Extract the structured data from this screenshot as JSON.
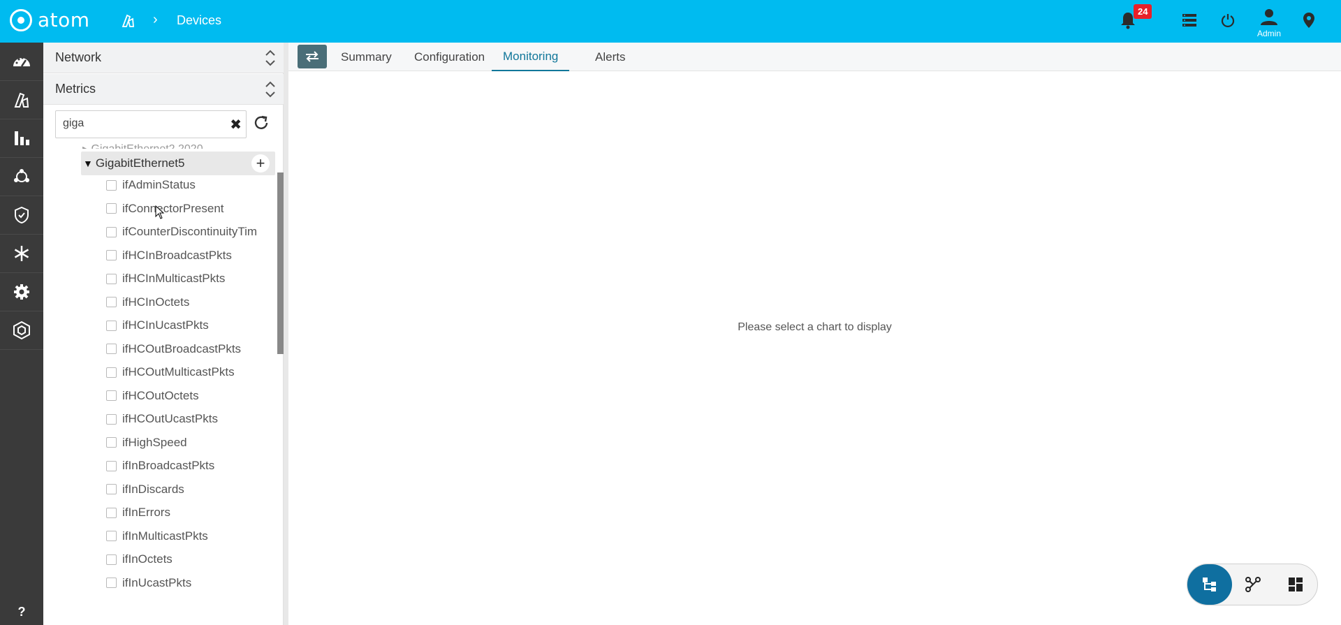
{
  "app": {
    "logo_text": "atom",
    "breadcrumb": {
      "current": "Devices"
    },
    "notifications_count": "24",
    "user_label": "Admin"
  },
  "colors": {
    "topbar": "#00bbf0",
    "nav": "#3a3a3a",
    "accent": "#11779a",
    "badge": "#e8202a"
  },
  "leftnav": {
    "icons": [
      "dashboard-icon",
      "devices-icon",
      "analytics-icon",
      "topology-icon",
      "security-icon",
      "snowflake-icon",
      "settings-icon",
      "packages-icon"
    ],
    "help_label": "?"
  },
  "sidepanel": {
    "sections": [
      {
        "title": "Network"
      },
      {
        "title": "Metrics"
      }
    ],
    "search": {
      "value": "giga",
      "placeholder": ""
    },
    "tree": {
      "parent": "GigabitEthernet5",
      "items": [
        "ifAdminStatus",
        "ifConnectorPresent",
        "ifCounterDiscontinuityTim",
        "ifHCInBroadcastPkts",
        "ifHCInMulticastPkts",
        "ifHCInOctets",
        "ifHCInUcastPkts",
        "ifHCOutBroadcastPkts",
        "ifHCOutMulticastPkts",
        "ifHCOutOctets",
        "ifHCOutUcastPkts",
        "ifHighSpeed",
        "ifInBroadcastPkts",
        "ifInDiscards",
        "ifInErrors",
        "ifInMulticastPkts",
        "ifInOctets",
        "ifInUcastPkts"
      ]
    }
  },
  "main": {
    "tabs": [
      {
        "label": "Summary",
        "active": false
      },
      {
        "label": "Configuration",
        "active": false
      },
      {
        "label": "Monitoring",
        "active": true
      },
      {
        "label": "Alerts",
        "active": false
      }
    ],
    "empty_message": "Please select a chart to display"
  },
  "view_switcher": {
    "options": [
      "tree-view-icon",
      "graph-view-icon",
      "dashboard-view-icon"
    ],
    "selected": "tree-view-icon"
  }
}
